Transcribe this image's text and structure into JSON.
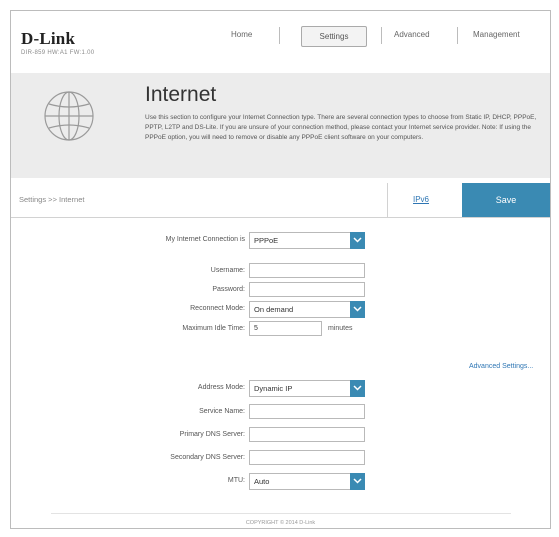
{
  "header": {
    "logo": "D-Link",
    "logo_sub": "DIR-859   HW:A1   FW:1.00",
    "nav": [
      "Home",
      "Settings",
      "Advanced",
      "Management"
    ],
    "active_nav": "Settings"
  },
  "hero": {
    "title": "Internet",
    "description": "Use this section to configure your Internet Connection type. There are several connection types to choose from Static IP, DHCP, PPPoE, PPTP, L2TP and DS-Lite. If you are unsure of your connection method, please contact your Internet service provider. Note: If using the PPPoE option, you will need to remove or disable any PPPoE client software on your computers."
  },
  "breadcrumb": "Settings >> Internet",
  "actions": {
    "ipv6": "IPv6",
    "save": "Save"
  },
  "form": {
    "connection_label": "My Internet Connection is",
    "connection_value": "PPPoE",
    "username_label": "Username:",
    "username_value": "",
    "password_label": "Password:",
    "password_value": "",
    "reconnect_label": "Reconnect Mode:",
    "reconnect_value": "On demand",
    "idle_label": "Maximum Idle Time:",
    "idle_value": "5",
    "idle_unit": "minutes",
    "advanced_link": "Advanced Settings...",
    "address_label": "Address Mode:",
    "address_value": "Dynamic IP",
    "service_label": "Service Name:",
    "service_value": "",
    "dns1_label": "Primary DNS Server:",
    "dns1_value": "",
    "dns2_label": "Secondary DNS Server:",
    "dns2_value": "",
    "mtu_label": "MTU:",
    "mtu_value": "Auto"
  },
  "footer": "COPYRIGHT © 2014 D-Link",
  "colors": {
    "accent": "#3a8ab3",
    "link": "#2e76b4",
    "hero_bg": "#ececec"
  },
  "icons": [
    "globe-icon",
    "chevron-down-icon"
  ]
}
